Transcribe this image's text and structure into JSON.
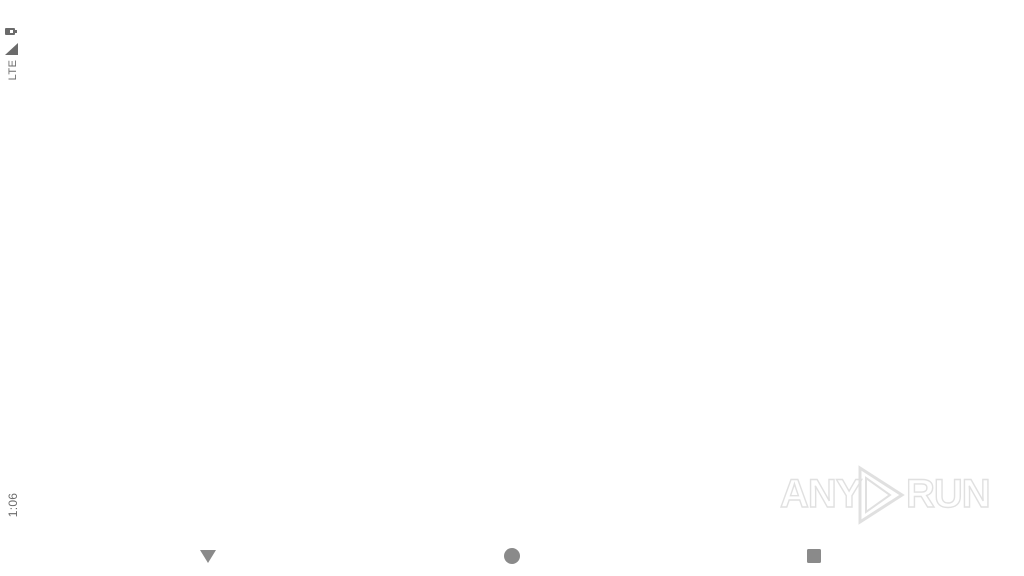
{
  "status_bar": {
    "clock": "1:06",
    "network": "LTE",
    "signal_icon": "signal-icon",
    "battery_icon": "battery-icon"
  },
  "watermark": {
    "left_text": "ANY",
    "right_text": "RUN",
    "icon": "play-icon"
  },
  "nav_bar": {
    "back_icon": "back-triangle-icon",
    "home_icon": "home-circle-icon",
    "recents_icon": "recents-square-icon"
  },
  "colors": {
    "background": "#ffffff",
    "status_text": "#6b6b6b",
    "nav_icon": "#8a8a8a"
  }
}
